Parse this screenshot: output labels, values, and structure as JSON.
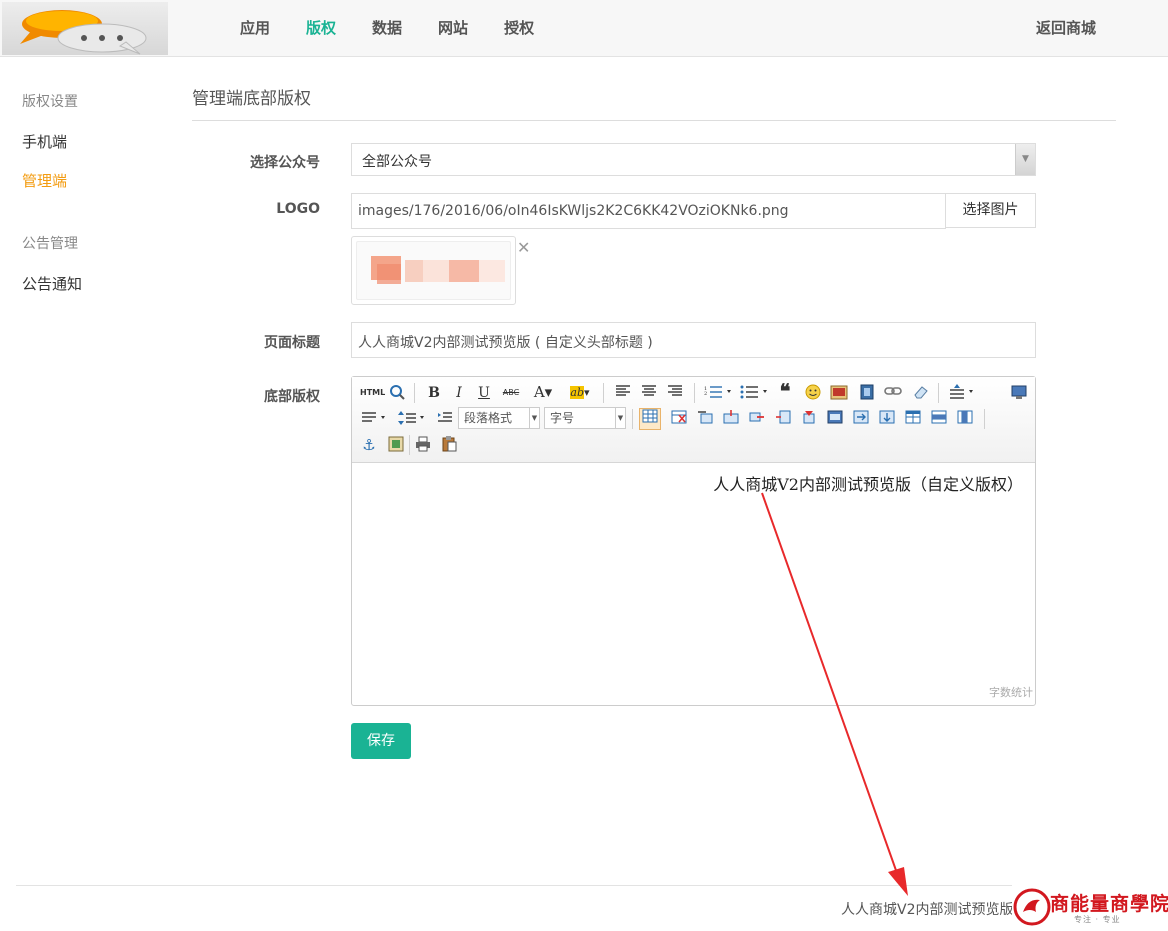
{
  "header": {
    "nav": [
      {
        "label": "应用",
        "active": false
      },
      {
        "label": "版权",
        "active": true
      },
      {
        "label": "数据",
        "active": false
      },
      {
        "label": "网站",
        "active": false
      },
      {
        "label": "授权",
        "active": false
      }
    ],
    "back_link": "返回商城"
  },
  "sidebar": {
    "group1": "版权设置",
    "item_mobile": "手机端",
    "item_admin": "管理端",
    "group2": "公告管理",
    "item_notice": "公告通知"
  },
  "main": {
    "title": "管理端底部版权",
    "form": {
      "account_label": "选择公众号",
      "account_value": "全部公众号",
      "logo_label": "LOGO",
      "logo_value": "images/176/2016/06/oIn46IsKWljs2K2C6KK42VOziOKNk6.png",
      "choose_image": "选择图片",
      "remove_icon": "✕",
      "page_title_label": "页面标题",
      "page_title_value": "人人商城V2内部测试预览版 ( 自定义头部标题 )",
      "copyright_label": "底部版权",
      "editor_paragraph_format": "段落格式",
      "editor_font_size": "字号",
      "editor_content": "人人商城V2内部测试预览版（自定义版权）",
      "word_count": "字数统计",
      "save_label": "保存"
    }
  },
  "footer": {
    "text": "人人商城V2内部测试预览版（自定义版权）"
  },
  "watermark": {
    "title": "商能量商學院",
    "subtitle": "专注 · 专业"
  },
  "colors": {
    "accent": "#1ab394",
    "active_sidebar": "#f39c12",
    "arrow": "#e8292b"
  }
}
